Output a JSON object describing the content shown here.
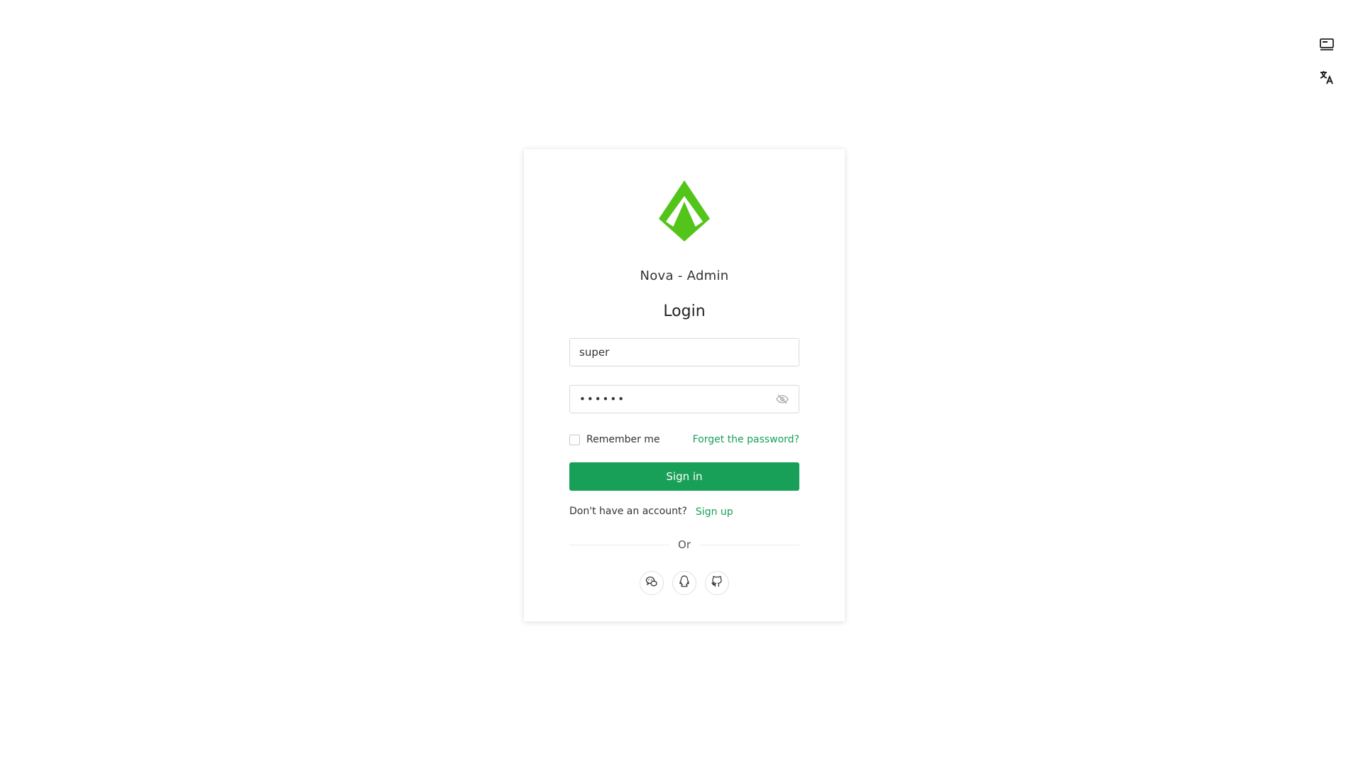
{
  "app": {
    "title": "Nova - Admin",
    "brand_color": "#52c41a",
    "accent_color": "#18a058"
  },
  "top_tools": [
    {
      "icon": "monitor-icon"
    },
    {
      "icon": "translate-icon"
    }
  ],
  "login": {
    "heading": "Login",
    "username": {
      "value": "super",
      "placeholder": ""
    },
    "password": {
      "masked_value": "••••••",
      "icon": "eye-off-icon"
    },
    "remember_label": "Remember me",
    "remember_checked": false,
    "forgot_label": "Forget the password?",
    "submit_label": "Sign in",
    "signup_prompt": "Don't have an account?",
    "signup_label": "Sign up",
    "divider_text": "Or",
    "social": [
      {
        "icon": "wechat-icon"
      },
      {
        "icon": "qq-icon"
      },
      {
        "icon": "github-icon"
      }
    ]
  }
}
